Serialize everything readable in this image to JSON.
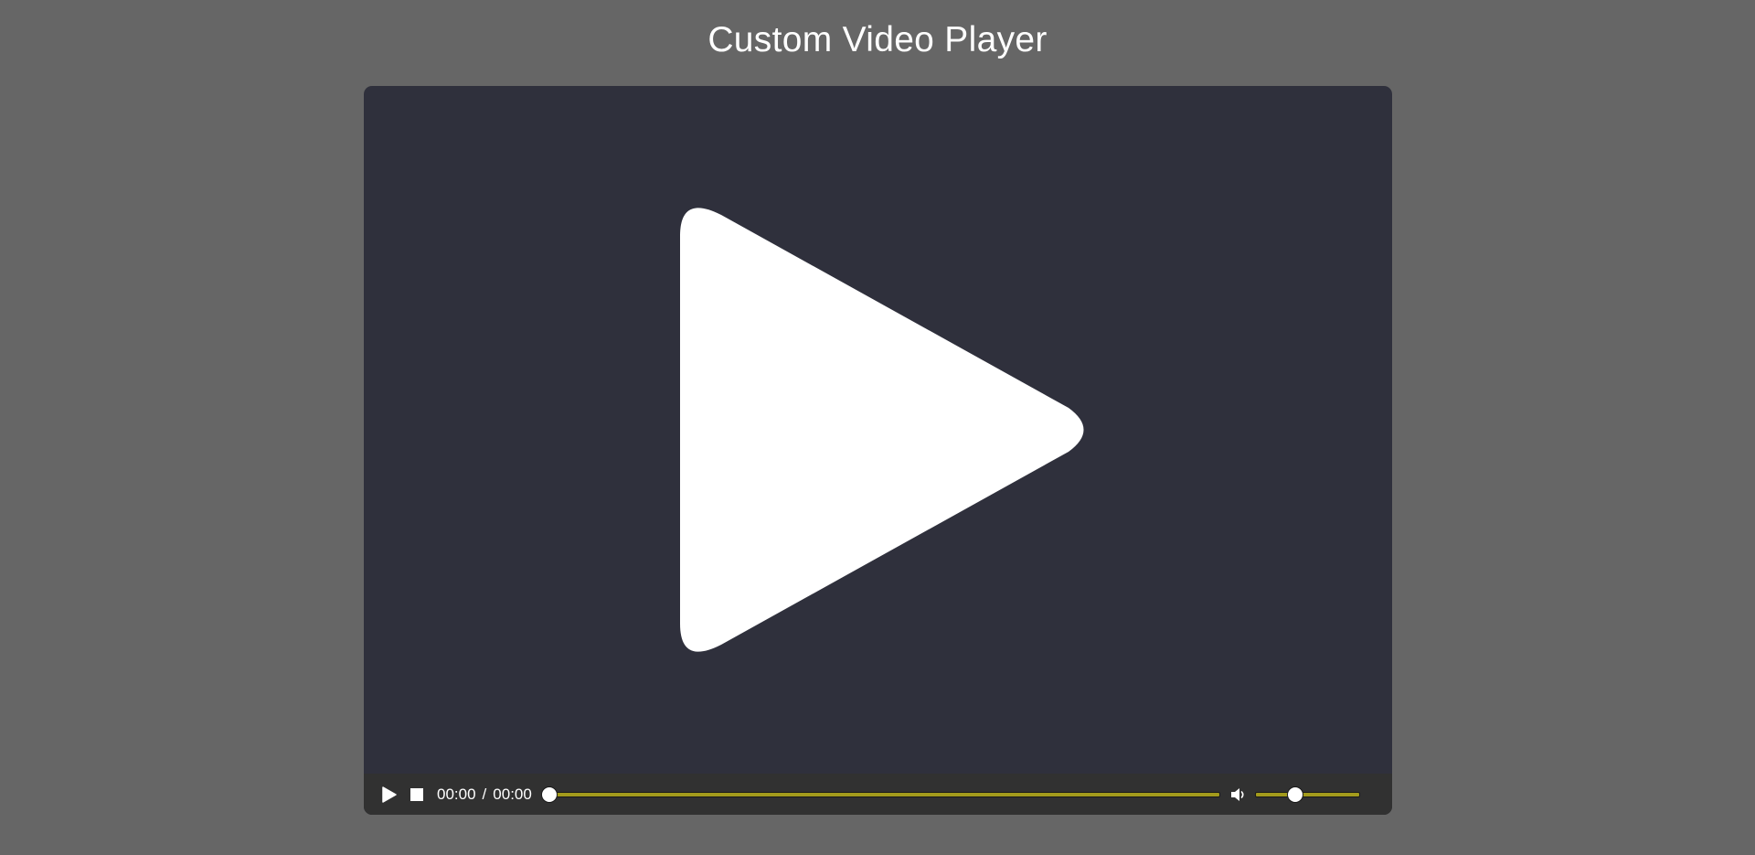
{
  "page": {
    "title": "Custom Video Player"
  },
  "player": {
    "big_play_icon": "play-icon",
    "controls": {
      "play_icon": "play-icon",
      "stop_icon": "stop-icon",
      "current_time": "00:00",
      "separator": "/",
      "duration": "00:00",
      "progress_fraction": 0,
      "volume_icon": "volume-icon",
      "volume_fraction": 0.38
    }
  },
  "colors": {
    "page_background": "#666666",
    "player_background": "#2f303c",
    "controls_background": "#313131",
    "track_accent": "#a39b1c",
    "icon_color": "#ffffff"
  }
}
